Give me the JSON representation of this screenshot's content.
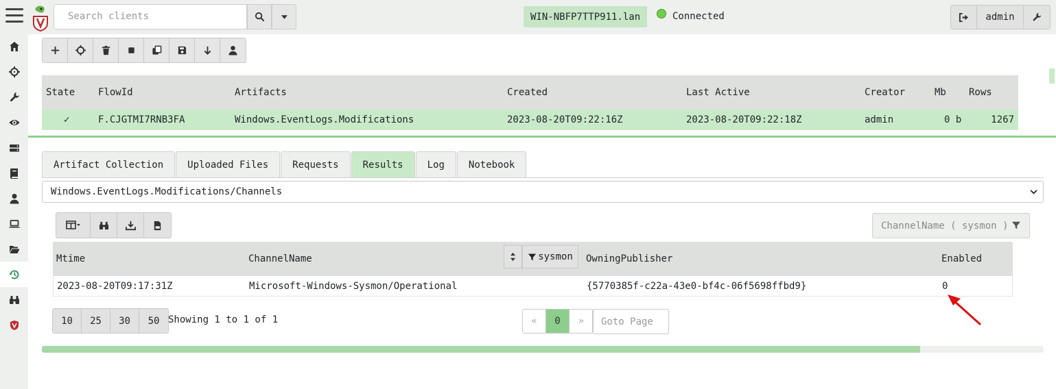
{
  "topbar": {
    "search_placeholder": "Search clients",
    "hostname": "WIN-NBFP7TTP911.lan",
    "status": "Connected",
    "user": "admin"
  },
  "sidebar": {
    "icons": [
      "home-icon",
      "crosshair-icon",
      "wrench-icon",
      "eye-icon",
      "server-icon",
      "book-icon",
      "user-icon",
      "laptop-icon",
      "folder-open-icon",
      "history-icon",
      "binoculars-icon",
      "velociraptor-shield-icon"
    ]
  },
  "toolbar": {
    "buttons": [
      "plus-icon",
      "crosshair-icon",
      "trash-icon",
      "stop-icon",
      "copy-icon",
      "save-icon",
      "download-icon",
      "user-icon"
    ]
  },
  "flows": {
    "headers": [
      "State",
      "FlowId",
      "Artifacts",
      "Created",
      "Last Active",
      "Creator",
      "Mb",
      "Rows"
    ],
    "row": {
      "state": "✓",
      "flow_id": "F.CJGTMI7RNB3FA",
      "artifact": "Windows.EventLogs.Modifications",
      "created": "2023-08-20T09:22:16Z",
      "last_active": "2023-08-20T09:22:18Z",
      "creator": "admin",
      "mb": "0 b",
      "rows": "1267"
    }
  },
  "tabs": [
    "Artifact Collection",
    "Uploaded Files",
    "Requests",
    "Results",
    "Log",
    "Notebook"
  ],
  "active_tab": "Results",
  "artifact_select": "Windows.EventLogs.Modifications/Channels",
  "filter_box": "ChannelName ( sysmon )",
  "results": {
    "headers": [
      "Mtime",
      "ChannelName",
      "OwningPublisher",
      "Enabled"
    ],
    "column_filter": "sysmon",
    "row": {
      "mtime": "2023-08-20T09:17:31Z",
      "channel": "Microsoft-Windows-Sysmon/Operational",
      "publisher": "{5770385f-c22a-43e0-bf4c-06f5698ffbd9}",
      "enabled": "0"
    }
  },
  "paging": {
    "sizes": [
      "10",
      "25",
      "30",
      "50"
    ],
    "showing": "Showing 1 to 1 of 1",
    "prev": "«",
    "current": "0",
    "next": "»",
    "goto_placeholder": "Goto Page",
    "progress": 0.877
  },
  "colors": {
    "accent_green": "#c9eac9",
    "annotation_red": "#e01010"
  }
}
